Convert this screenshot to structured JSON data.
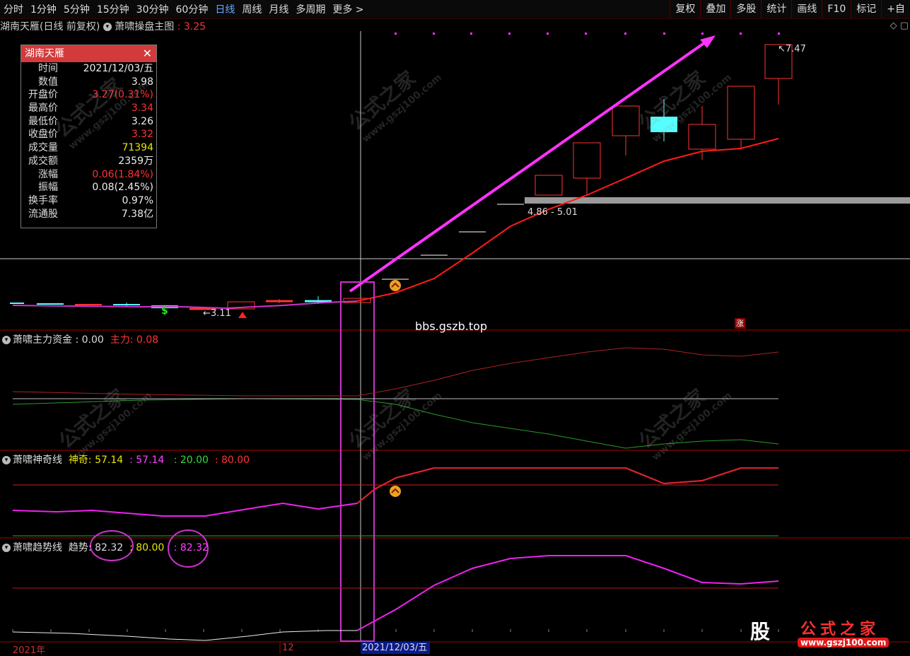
{
  "toolbar": {
    "periods": [
      "分时",
      "1分钟",
      "5分钟",
      "15分钟",
      "30分钟",
      "60分钟",
      "日线",
      "周线",
      "月线",
      "多周期",
      "更多"
    ],
    "active_period": "日线",
    "more_arrow": ">",
    "right_buttons": [
      "复权",
      "叠加",
      "多股",
      "统计",
      "画线",
      "F10",
      "标记",
      "+自"
    ]
  },
  "header": {
    "stock_title": "湖南天雁(日线 前复权)",
    "formula_name": "萧啸操盘主图",
    "formula_value": ": 3.25"
  },
  "info_panel": {
    "title": "湖南天雁",
    "close": "✕",
    "rows": [
      {
        "k": "时间",
        "v": "2021/12/03/五",
        "c": ""
      },
      {
        "k": "数值",
        "v": "3.98",
        "c": ""
      },
      {
        "k": "开盘价",
        "v": "3.27(0.31%)",
        "c": "red"
      },
      {
        "k": "最高价",
        "v": "3.34",
        "c": "red"
      },
      {
        "k": "最低价",
        "v": "3.26",
        "c": ""
      },
      {
        "k": "收盘价",
        "v": "3.32",
        "c": "red"
      },
      {
        "k": "成交量",
        "v": "71394",
        "c": "yellow"
      },
      {
        "k": "成交额",
        "v": "2359万",
        "c": ""
      },
      {
        "k": "涨幅",
        "v": "0.06(1.84%)",
        "c": "red"
      },
      {
        "k": "振幅",
        "v": "0.08(2.45%)",
        "c": ""
      },
      {
        "k": "换手率",
        "v": "0.97%",
        "c": ""
      },
      {
        "k": "流通股",
        "v": "7.38亿",
        "c": ""
      }
    ]
  },
  "main_chart": {
    "high_label": "7.47",
    "low_label": "3.11",
    "range_label": "4.86 - 5.01",
    "url_text": "bbs.gszb.top",
    "zhang_badge": "涨",
    "colors": {
      "up": "#ff3333",
      "down": "#55ffff",
      "ma": "#ff1a1a",
      "arrow": "#ff33ff",
      "gray_bar": "#9a9a9a"
    }
  },
  "indicator1": {
    "name": "萧啸主力资金",
    "value": ": 0.00",
    "label2": "主力",
    "value2": ": 0.08"
  },
  "indicator2": {
    "name": "萧啸神奇线",
    "label": "神奇",
    "v1": ": 57.14",
    "v2": ": 57.14",
    "v3": ": 20.00",
    "v4": ": 80.00"
  },
  "indicator3": {
    "name": "萧啸趋势线",
    "label": "趋势",
    "v1": ": 82.32",
    "v2": ": 80.00",
    "v3": ": 82.32"
  },
  "bottom": {
    "year_label": "2021年",
    "month_label": "12",
    "selected_date": "2021/12/03/五"
  },
  "logo": {
    "badge": "股",
    "name": "公式之家",
    "url": "www.gszj100.com"
  },
  "watermark": {
    "text": "公式之家",
    "url": "www.gszj100.com"
  }
}
